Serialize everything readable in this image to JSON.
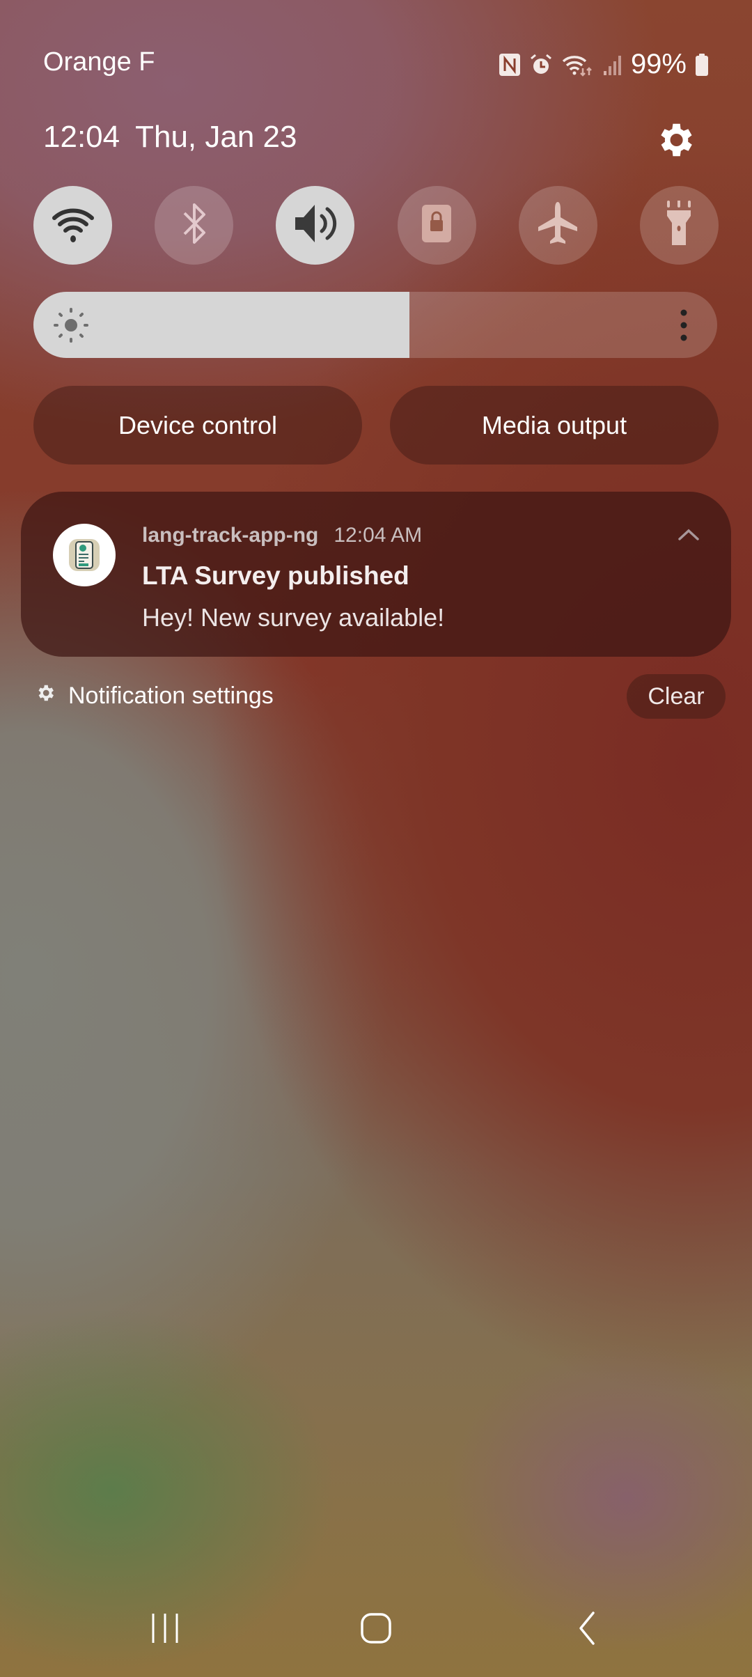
{
  "status_bar": {
    "carrier": "Orange F",
    "icons": [
      "nfc-icon",
      "alarm-icon",
      "wifi-data-icon",
      "signal-icon",
      "battery-icon"
    ],
    "battery_percent": "99%"
  },
  "header": {
    "time": "12:04",
    "date": "Thu, Jan 23",
    "settings_icon": "gear-icon"
  },
  "quick_tiles": [
    {
      "name": "wifi",
      "icon": "wifi-icon",
      "state": "on"
    },
    {
      "name": "bluetooth",
      "icon": "bluetooth-icon",
      "state": "off"
    },
    {
      "name": "sound",
      "icon": "speaker-icon",
      "state": "on"
    },
    {
      "name": "rotation-lock",
      "icon": "lock-rotation-icon",
      "state": "off"
    },
    {
      "name": "airplane-mode",
      "icon": "airplane-icon",
      "state": "off"
    },
    {
      "name": "flashlight",
      "icon": "flashlight-icon",
      "state": "off"
    }
  ],
  "brightness": {
    "level_percent": 55,
    "icon": "sun-icon",
    "more_icon": "more-vertical-icon"
  },
  "buttons": {
    "device_control": "Device control",
    "media_output": "Media output"
  },
  "notification": {
    "app_name": "lang-track-app-ng",
    "time": "12:04 AM",
    "title": "LTA Survey published",
    "body": "Hey! New survey available!",
    "expand_icon": "chevron-up-icon"
  },
  "footer": {
    "notification_settings": "Notification settings",
    "clear": "Clear"
  },
  "nav_bar": {
    "recents": "recents-icon",
    "home": "home-icon",
    "back": "back-icon"
  }
}
